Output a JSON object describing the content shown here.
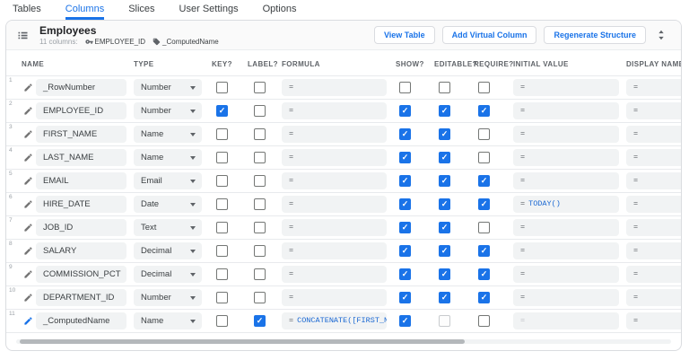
{
  "tabs": [
    {
      "label": "Tables",
      "active": false
    },
    {
      "label": "Columns",
      "active": true
    },
    {
      "label": "Slices",
      "active": false
    },
    {
      "label": "User Settings",
      "active": false
    },
    {
      "label": "Options",
      "active": false
    }
  ],
  "card_header": {
    "title": "Employees",
    "subtitle_count": "11 columns:",
    "key_column": "EMPLOYEE_ID",
    "label_column": "_ComputedName",
    "buttons": [
      {
        "label": "View Table"
      },
      {
        "label": "Add Virtual Column"
      },
      {
        "label": "Regenerate Structure"
      }
    ]
  },
  "columns_table": {
    "headers": [
      "NAME",
      "TYPE",
      "KEY?",
      "LABEL?",
      "FORMULA",
      "SHOW?",
      "EDITABLE?",
      "REQUIRE?",
      "INITIAL VALUE",
      "DISPLAY NAME"
    ],
    "rows": [
      {
        "num": "1",
        "name": "_RowNumber",
        "type": "Number",
        "key": "unchecked",
        "label": "unchecked",
        "formula_eq": "=",
        "formula_expr": "",
        "show": "unchecked",
        "editable": "unchecked",
        "require": "unchecked",
        "initial_eq": "=",
        "initial_expr": "",
        "initial_dim": false,
        "display_eq": "=",
        "virtual": false
      },
      {
        "num": "2",
        "name": "EMPLOYEE_ID",
        "type": "Number",
        "key": "checked",
        "label": "unchecked",
        "formula_eq": "=",
        "formula_expr": "",
        "show": "checked",
        "editable": "checked",
        "require": "checked",
        "initial_eq": "=",
        "initial_expr": "",
        "initial_dim": false,
        "display_eq": "=",
        "virtual": false
      },
      {
        "num": "3",
        "name": "FIRST_NAME",
        "type": "Name",
        "key": "unchecked",
        "label": "unchecked",
        "formula_eq": "=",
        "formula_expr": "",
        "show": "checked",
        "editable": "checked",
        "require": "unchecked",
        "initial_eq": "=",
        "initial_expr": "",
        "initial_dim": false,
        "display_eq": "=",
        "virtual": false
      },
      {
        "num": "4",
        "name": "LAST_NAME",
        "type": "Name",
        "key": "unchecked",
        "label": "unchecked",
        "formula_eq": "=",
        "formula_expr": "",
        "show": "checked",
        "editable": "checked",
        "require": "unchecked",
        "initial_eq": "=",
        "initial_expr": "",
        "initial_dim": false,
        "display_eq": "=",
        "virtual": false
      },
      {
        "num": "5",
        "name": "EMAIL",
        "type": "Email",
        "key": "unchecked",
        "label": "unchecked",
        "formula_eq": "=",
        "formula_expr": "",
        "show": "checked",
        "editable": "checked",
        "require": "checked",
        "initial_eq": "=",
        "initial_expr": "",
        "initial_dim": false,
        "display_eq": "=",
        "virtual": false
      },
      {
        "num": "6",
        "name": "HIRE_DATE",
        "type": "Date",
        "key": "unchecked",
        "label": "unchecked",
        "formula_eq": "=",
        "formula_expr": "",
        "show": "checked",
        "editable": "checked",
        "require": "checked",
        "initial_eq": "=",
        "initial_expr": "TODAY()",
        "initial_dim": false,
        "display_eq": "=",
        "virtual": false
      },
      {
        "num": "7",
        "name": "JOB_ID",
        "type": "Text",
        "key": "unchecked",
        "label": "unchecked",
        "formula_eq": "=",
        "formula_expr": "",
        "show": "checked",
        "editable": "checked",
        "require": "unchecked",
        "initial_eq": "=",
        "initial_expr": "",
        "initial_dim": false,
        "display_eq": "=",
        "virtual": false
      },
      {
        "num": "8",
        "name": "SALARY",
        "type": "Decimal",
        "key": "unchecked",
        "label": "unchecked",
        "formula_eq": "=",
        "formula_expr": "",
        "show": "checked",
        "editable": "checked",
        "require": "checked",
        "initial_eq": "=",
        "initial_expr": "",
        "initial_dim": false,
        "display_eq": "=",
        "virtual": false
      },
      {
        "num": "9",
        "name": "COMMISSION_PCT",
        "type": "Decimal",
        "key": "unchecked",
        "label": "unchecked",
        "formula_eq": "=",
        "formula_expr": "",
        "show": "checked",
        "editable": "checked",
        "require": "checked",
        "initial_eq": "=",
        "initial_expr": "",
        "initial_dim": false,
        "display_eq": "=",
        "virtual": false
      },
      {
        "num": "10",
        "name": "DEPARTMENT_ID",
        "type": "Number",
        "key": "unchecked",
        "label": "unchecked",
        "formula_eq": "=",
        "formula_expr": "",
        "show": "checked",
        "editable": "checked",
        "require": "checked",
        "initial_eq": "=",
        "initial_expr": "",
        "initial_dim": false,
        "display_eq": "=",
        "virtual": false
      },
      {
        "num": "11",
        "name": "_ComputedName",
        "type": "Name",
        "key": "unchecked",
        "label": "checked",
        "formula_eq": "=",
        "formula_expr": "CONCATENATE([FIRST_NA",
        "show": "checked",
        "editable": "disabled",
        "require": "unchecked",
        "initial_eq": "=",
        "initial_expr": "",
        "initial_dim": true,
        "display_eq": "=",
        "virtual": true
      }
    ]
  },
  "colors": {
    "accent": "#1a73e8",
    "formula_blue": "#1967d2",
    "field_bg": "#f1f3f4",
    "border": "#dadce0"
  }
}
